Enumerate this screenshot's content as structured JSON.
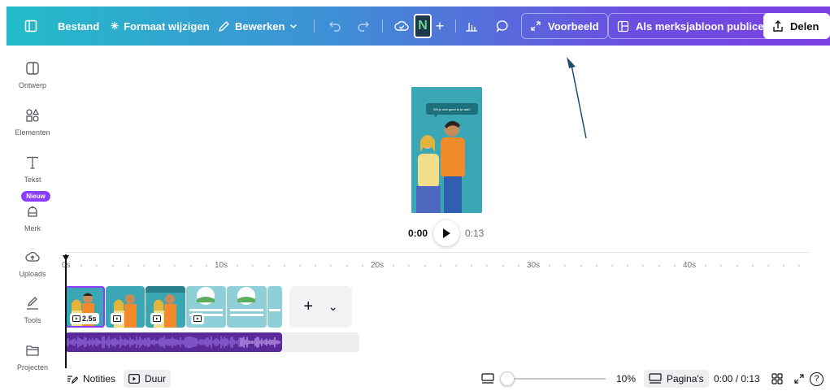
{
  "topbar": {
    "file_label": "Bestand",
    "resize_label": "Formaat wijzigen",
    "edit_label": "Bewerken",
    "avatar_letter": "N",
    "preview_label": "Voorbeeld",
    "publish_template_label": "Als merksjabloon publiceren",
    "share_label": "Delen"
  },
  "sidebar": {
    "items": [
      {
        "label": "Ontwerp",
        "icon": "layout-icon"
      },
      {
        "label": "Elementen",
        "icon": "elements-icon"
      },
      {
        "label": "Tekst",
        "icon": "text-icon"
      },
      {
        "label": "Merk",
        "icon": "brand-icon"
      },
      {
        "label": "Uploads",
        "icon": "upload-icon"
      },
      {
        "label": "Tools",
        "icon": "draw-icon"
      },
      {
        "label": "Projecten",
        "icon": "folder-icon"
      }
    ],
    "new_badge": "Nieuw"
  },
  "design": {
    "bubble_text": "Wil je met goed te je wat?"
  },
  "playback": {
    "current_time": "0:00",
    "total_time": "0:13"
  },
  "timeline": {
    "ticks": [
      "0s",
      "10s",
      "20s",
      "30s",
      "40s"
    ],
    "first_clip_duration": "2.5s",
    "add_symbol": "+",
    "chevron_symbol": "⌄"
  },
  "bottom": {
    "notes_label": "Notities",
    "duration_label": "Duur",
    "zoom_level": "10%",
    "zoom_fraction": 0.0,
    "pages_label": "Pagina's",
    "time_readout": "0:00 / 0:13",
    "help_symbol": "?"
  },
  "colors": {
    "accent": "#8b3dff",
    "gradient_start": "#23bcc9",
    "gradient_end": "#7b3fe4",
    "audio": "#5a2a9a"
  }
}
